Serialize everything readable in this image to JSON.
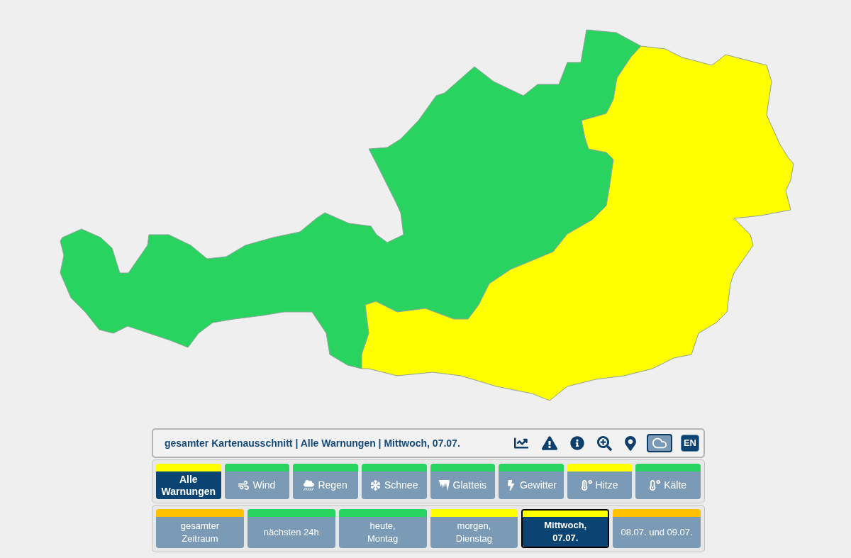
{
  "map": {
    "regions": [
      {
        "color": "#28d35f"
      },
      {
        "color": "#ffff00"
      }
    ]
  },
  "panel": {
    "title": "gesamter Kartenausschnitt | Alle Warnungen | Mittwoch, 07.07.",
    "tools": [
      {
        "kind": "chart",
        "selected": false
      },
      {
        "kind": "warning",
        "selected": false
      },
      {
        "kind": "info",
        "selected": false
      },
      {
        "kind": "zoom",
        "selected": false
      },
      {
        "kind": "location",
        "selected": false
      },
      {
        "kind": "cloud",
        "selected": true
      }
    ],
    "language_button": "EN"
  },
  "filters": [
    {
      "kind": "all",
      "label": "Alle Warnungen",
      "color": "#ffff00",
      "selected": true
    },
    {
      "kind": "wind",
      "label": "Wind",
      "color": "#28d35f",
      "selected": false
    },
    {
      "kind": "rain",
      "label": "Regen",
      "color": "#28d35f",
      "selected": false
    },
    {
      "kind": "snow",
      "label": "Schnee",
      "color": "#28d35f",
      "selected": false
    },
    {
      "kind": "ice",
      "label": "Glatteis",
      "color": "#28d35f",
      "selected": false
    },
    {
      "kind": "thunderstorm",
      "label": "Gewitter",
      "color": "#28d35f",
      "selected": false
    },
    {
      "kind": "heat",
      "label": "Hitze",
      "color": "#ffff00",
      "selected": false
    },
    {
      "kind": "cold",
      "label": "Kälte",
      "color": "#28d35f",
      "selected": false
    }
  ],
  "periods": [
    {
      "label": "gesamter\nZeitraum",
      "color": "#ffc000",
      "selected": false
    },
    {
      "label": "nächsten 24h",
      "color": "#28d35f",
      "selected": false
    },
    {
      "label": "heute,\nMontag",
      "color": "#28d35f",
      "selected": false
    },
    {
      "label": "morgen,\nDienstag",
      "color": "#ffff00",
      "selected": false
    },
    {
      "label": "Mittwoch,\n07.07.",
      "color": "#ffff00",
      "selected": true
    },
    {
      "label": "08.07. und 09.07.",
      "color": "#ffc000",
      "selected": false
    }
  ]
}
